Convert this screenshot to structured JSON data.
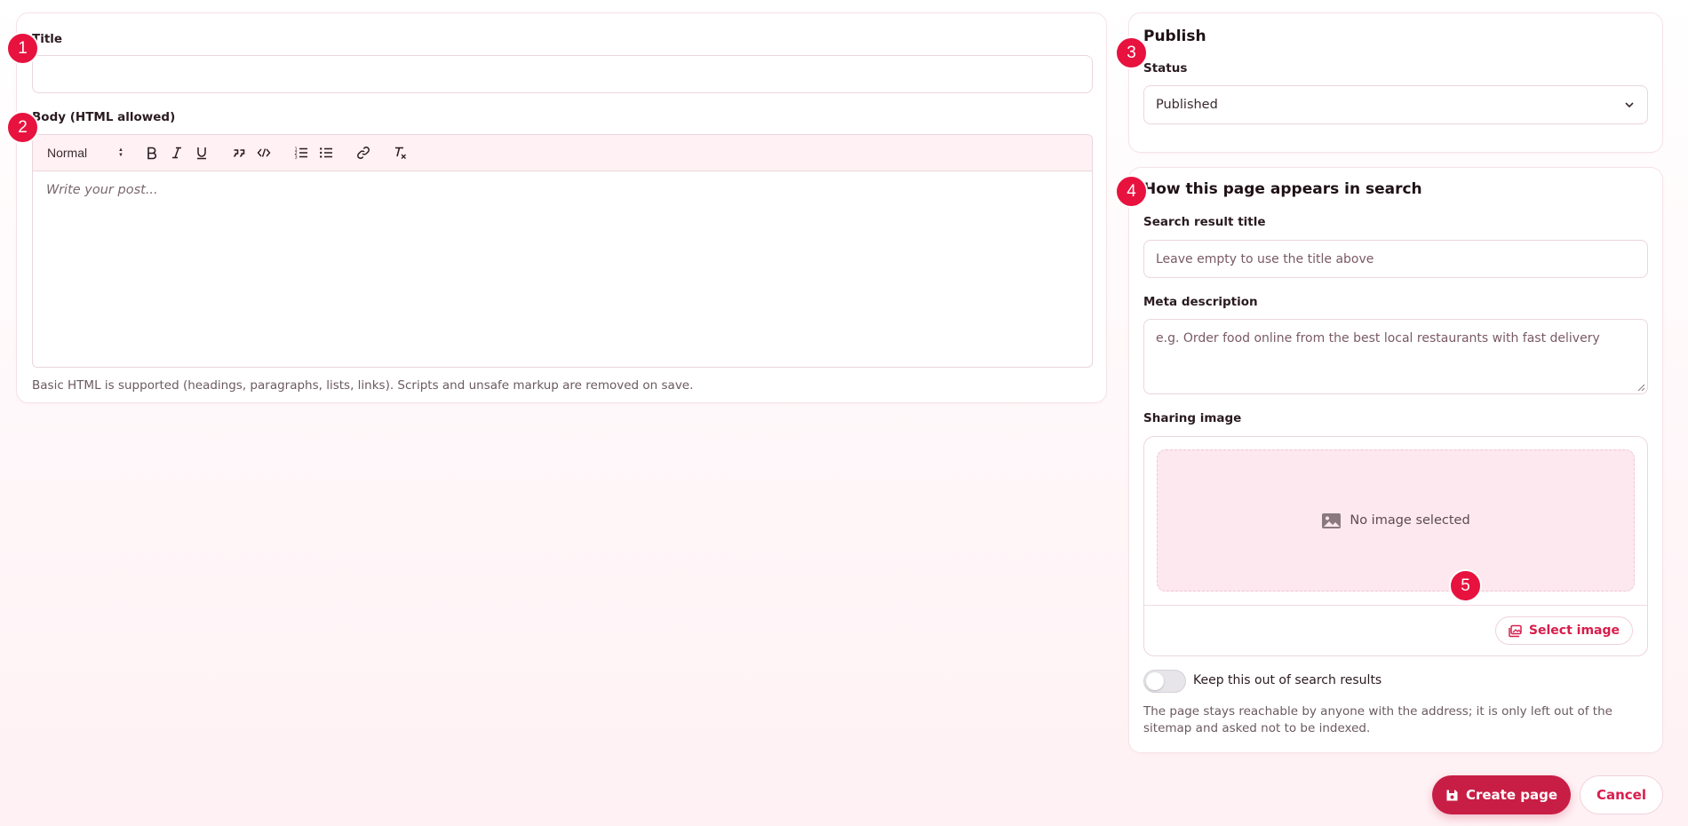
{
  "form": {
    "title_label": "Title",
    "title_value": "",
    "body_label": "Body (HTML allowed)",
    "body_placeholder": "Write your post...",
    "body_hint": "Basic HTML is supported (headings, paragraphs, lists, links). Scripts and unsafe markup are removed on save.",
    "toolbar": {
      "format_select": "Normal",
      "buttons": [
        "bold-icon",
        "italic-icon",
        "underline-icon",
        "blockquote-icon",
        "code-icon",
        "ordered-list-icon",
        "bullet-list-icon",
        "link-icon",
        "clear-format-icon"
      ]
    }
  },
  "publish": {
    "title": "Publish",
    "status_label": "Status",
    "status_value": "Published"
  },
  "seo": {
    "title": "How this page appears in search",
    "search_title_label": "Search result title",
    "search_title_placeholder": "Leave empty to use the title above",
    "meta_label": "Meta description",
    "meta_placeholder": "e.g. Order food online from the best local restaurants with fast delivery",
    "sharing_label": "Sharing image",
    "no_image_text": "No image selected",
    "select_image_label": "Select image",
    "noindex_label": "Keep this out of search results",
    "noindex_on": false,
    "noindex_help": "The page stays reachable by anyone with the address; it is only left out of the sitemap and asked not to be indexed."
  },
  "actions": {
    "create_label": "Create page",
    "cancel_label": "Cancel"
  },
  "badges": [
    "1",
    "2",
    "3",
    "4",
    "5"
  ],
  "colors": {
    "accent": "#c81e45",
    "badge": "#e8123f",
    "toolbar_bg": "#fff1f4"
  }
}
